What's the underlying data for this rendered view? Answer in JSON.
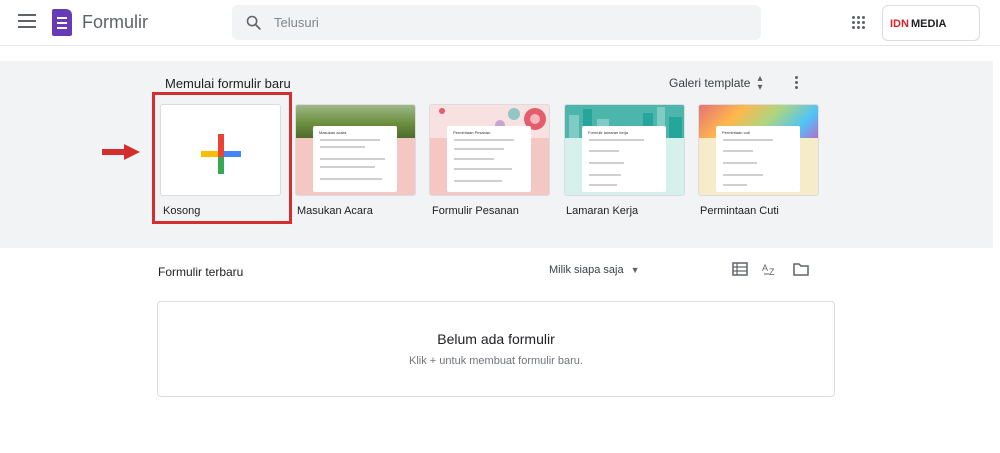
{
  "header": {
    "app_title": "Formulir",
    "search_placeholder": "Telusuri",
    "brand_part1": "IDN",
    "brand_part2": "MEDIA",
    "icons": [
      "menu-icon",
      "forms-logo-icon",
      "search-icon",
      "apps-grid-icon"
    ]
  },
  "gallery": {
    "title": "Memulai formulir baru",
    "template_gallery_label": "Galeri template",
    "templates": [
      {
        "label": "Kosong",
        "kind": "blank"
      },
      {
        "label": "Masukan Acara",
        "kind": "template",
        "header_color": "#6c8f3d",
        "bg_color": "#f4c7c3",
        "form_title": "Masukan acara"
      },
      {
        "label": "Formulir Pesanan",
        "kind": "template",
        "header_color": "#f8d9d9",
        "bg_color": "#f4c7c3",
        "form_title": "Permintaan Pesanan"
      },
      {
        "label": "Lamaran Kerja",
        "kind": "template",
        "header_color": "#4db6ac",
        "bg_color": "#d6f1ec",
        "form_title": "Formulir lamaran kerja"
      },
      {
        "label": "Permintaan Cuti",
        "kind": "template",
        "header_color": "#e57373",
        "bg_color": "#f6ecc9",
        "form_title": "Permintaan cuti"
      }
    ]
  },
  "recent": {
    "title": "Formulir terbaru",
    "owner_filter": "Milik siapa saja",
    "empty_title": "Belum ada formulir",
    "empty_subtitle": "Klik + untuk membuat formulir baru.",
    "icons": [
      "list-view-icon",
      "sort-az-icon",
      "folder-icon"
    ]
  },
  "colors": {
    "accent": "#673ab7",
    "highlight": "#d32f2f",
    "gallery_bg": "#f1f3f4"
  }
}
